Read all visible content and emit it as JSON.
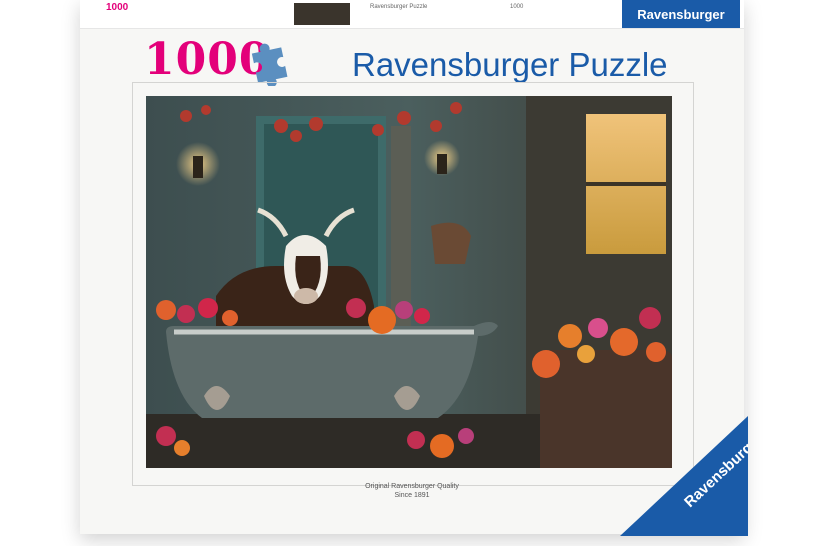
{
  "box": {
    "piece_count": "1000",
    "title": "Ravensburger Puzzle",
    "top_strip": {
      "side_number": "1000",
      "side_text": "Ravensburger Puzzle",
      "brand_tab": "Ravensburger",
      "small_text_1": "Ravensburger Puzzle",
      "small_text_2": "1000"
    },
    "caption_line1": "Original Ravensburger Quality",
    "caption_line2": "Since 1891",
    "corner_logo": "Ravensburger"
  },
  "colors": {
    "brand_blue": "#1a5ba8",
    "count_pink": "#e3007a"
  },
  "icons": [
    "puzzle-piece-icon"
  ],
  "artwork": "cow-in-bathtub-with-flowers"
}
